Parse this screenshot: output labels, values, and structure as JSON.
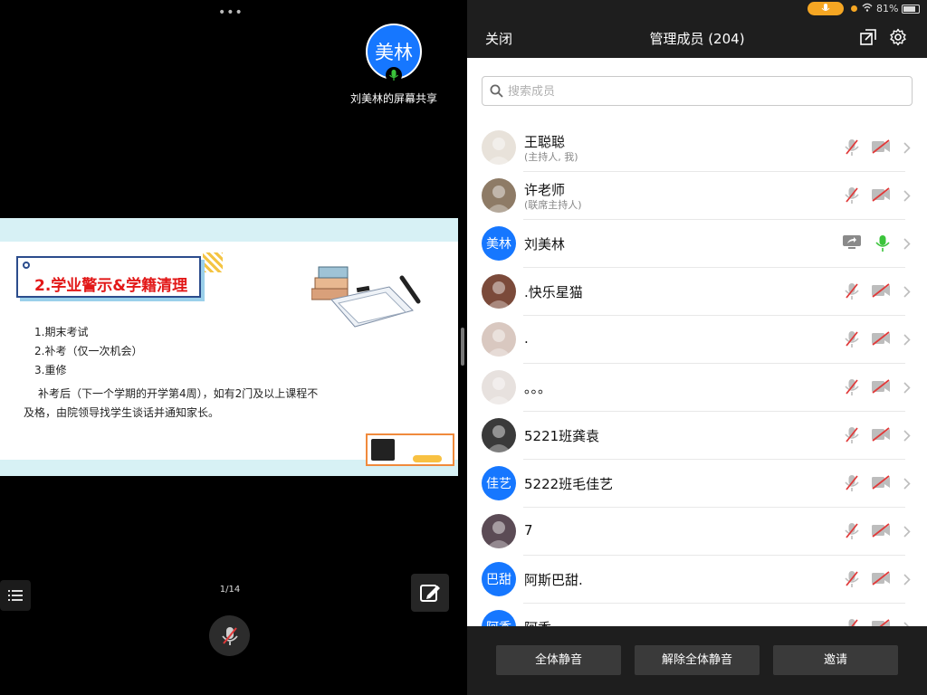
{
  "share": {
    "more_dots": "•••",
    "sharer_avatar_text": "美林",
    "sharer_label": "刘美林的屏幕共享",
    "page_indicator": "1/14"
  },
  "slide": {
    "title": "2.学业警示&学籍清理",
    "list": [
      "1.期末考试",
      "2.补考（仅一次机会）",
      "3.重修"
    ],
    "paragraph": "补考后（下一个学期的开学第4周），如有2门及以上课程不及格，由院领导找学生谈话并通知家长。"
  },
  "status_bar": {
    "battery": "81%"
  },
  "header": {
    "close_label": "关闭",
    "title": "管理成员 (204)"
  },
  "search": {
    "placeholder": "搜索成员"
  },
  "members": [
    {
      "name": "王聪聪",
      "role": "(主持人, 我)",
      "avatar": "photo",
      "avatar_color": "#e8e2da",
      "mic": "muted",
      "cam": "off"
    },
    {
      "name": "许老师",
      "role": "(联席主持人)",
      "avatar": "photo",
      "avatar_color": "#8e7b66",
      "mic": "muted",
      "cam": "off"
    },
    {
      "name": "刘美林",
      "role": "",
      "avatar": "美林",
      "avatar_color": "#1677ff",
      "mic": "on",
      "cam": "sharing"
    },
    {
      "name": ".快乐星猫",
      "role": "",
      "avatar": "photo",
      "avatar_color": "#7b4a3a",
      "mic": "muted",
      "cam": "off"
    },
    {
      "name": ".",
      "role": "",
      "avatar": "photo",
      "avatar_color": "#d9c8c0",
      "mic": "muted",
      "cam": "off"
    },
    {
      "name": "。。。",
      "role": "",
      "avatar": "photo",
      "avatar_color": "#e7e1de",
      "mic": "muted",
      "cam": "off"
    },
    {
      "name": "5221班龚袁",
      "role": "",
      "avatar": "photo",
      "avatar_color": "#3a3a3a",
      "mic": "muted",
      "cam": "off"
    },
    {
      "name": "5222班毛佳艺",
      "role": "",
      "avatar": "佳艺",
      "avatar_color": "#1677ff",
      "mic": "muted",
      "cam": "off"
    },
    {
      "name": "7",
      "role": "",
      "avatar": "photo",
      "avatar_color": "#5b4b55",
      "mic": "muted",
      "cam": "off"
    },
    {
      "name": "阿斯巴甜.",
      "role": "",
      "avatar": "巴甜",
      "avatar_color": "#1677ff",
      "mic": "muted",
      "cam": "off"
    },
    {
      "name": "阿香",
      "role": "",
      "avatar": "阿香",
      "avatar_color": "#1677ff",
      "mic": "muted",
      "cam": "off"
    }
  ],
  "footer": {
    "mute_all": "全体静音",
    "unmute_all": "解除全体静音",
    "invite": "邀请"
  },
  "colors": {
    "accent": "#1677ff",
    "mic_on": "#3bc43b",
    "muted_red": "#e03a3a",
    "status_orange": "#f5a623"
  }
}
